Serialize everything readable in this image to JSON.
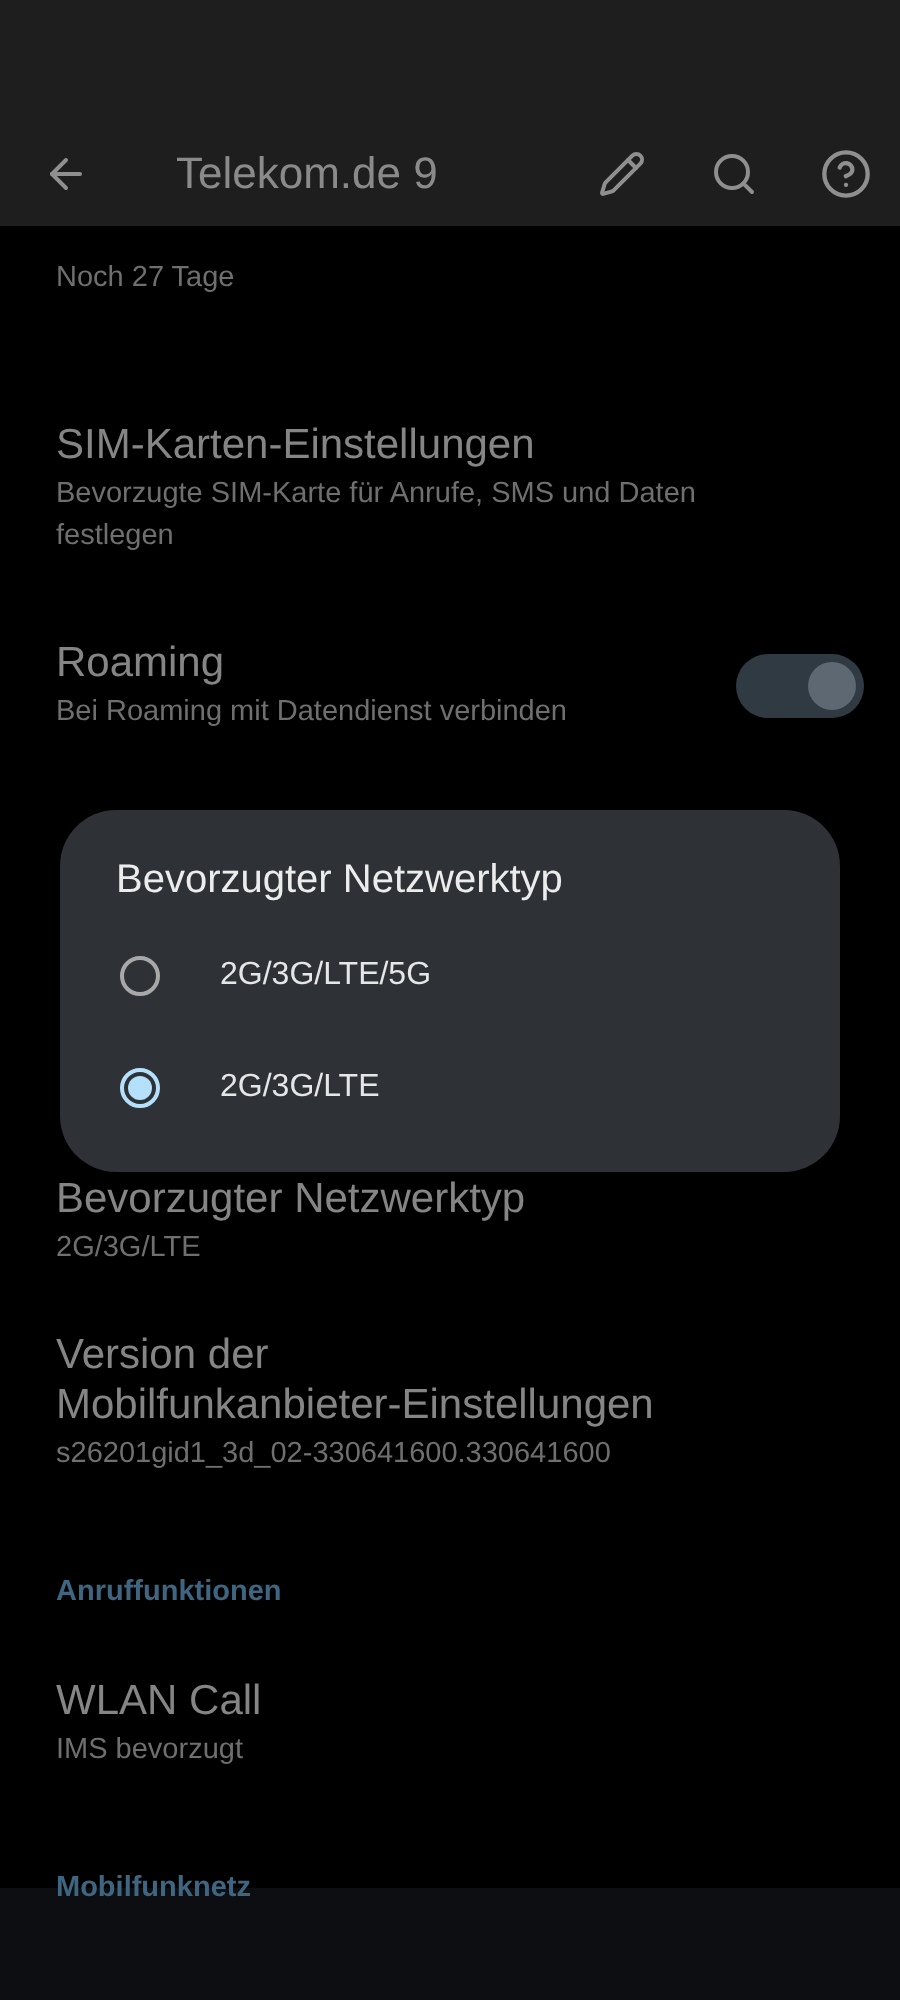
{
  "app_bar": {
    "title": "Telekom.de 9"
  },
  "items": [
    {
      "kind": "summary",
      "subtitle": "Noch 27 Tage"
    },
    {
      "kind": "item",
      "title": "SIM-Karten-Einstellungen",
      "subtitle": "Bevorzugte SIM-Karte für Anrufe, SMS und Daten festlegen"
    },
    {
      "kind": "switch",
      "title": "Roaming",
      "subtitle": "Bei Roaming mit Datendienst verbinden",
      "on": true
    },
    {
      "kind": "list",
      "title": "Bevorzugter Netzwerktyp",
      "subtitle": "2G/3G/LTE"
    },
    {
      "kind": "item",
      "title": "Version der Mobilfunkanbieter-Einstellungen",
      "subtitle": "s26201gid1_3d_02-330641600.330641600"
    },
    {
      "kind": "header",
      "title": "Anruffunktionen"
    },
    {
      "kind": "item",
      "title": "WLAN Call",
      "subtitle": "IMS bevorzugt"
    },
    {
      "kind": "header",
      "title": "Mobilfunknetz"
    }
  ],
  "dialog": {
    "title": "Bevorzugter Netzwerktyp",
    "options": [
      {
        "label": "2G/3G/LTE/5G",
        "selected": false
      },
      {
        "label": "2G/3G/LTE",
        "selected": true
      }
    ]
  }
}
